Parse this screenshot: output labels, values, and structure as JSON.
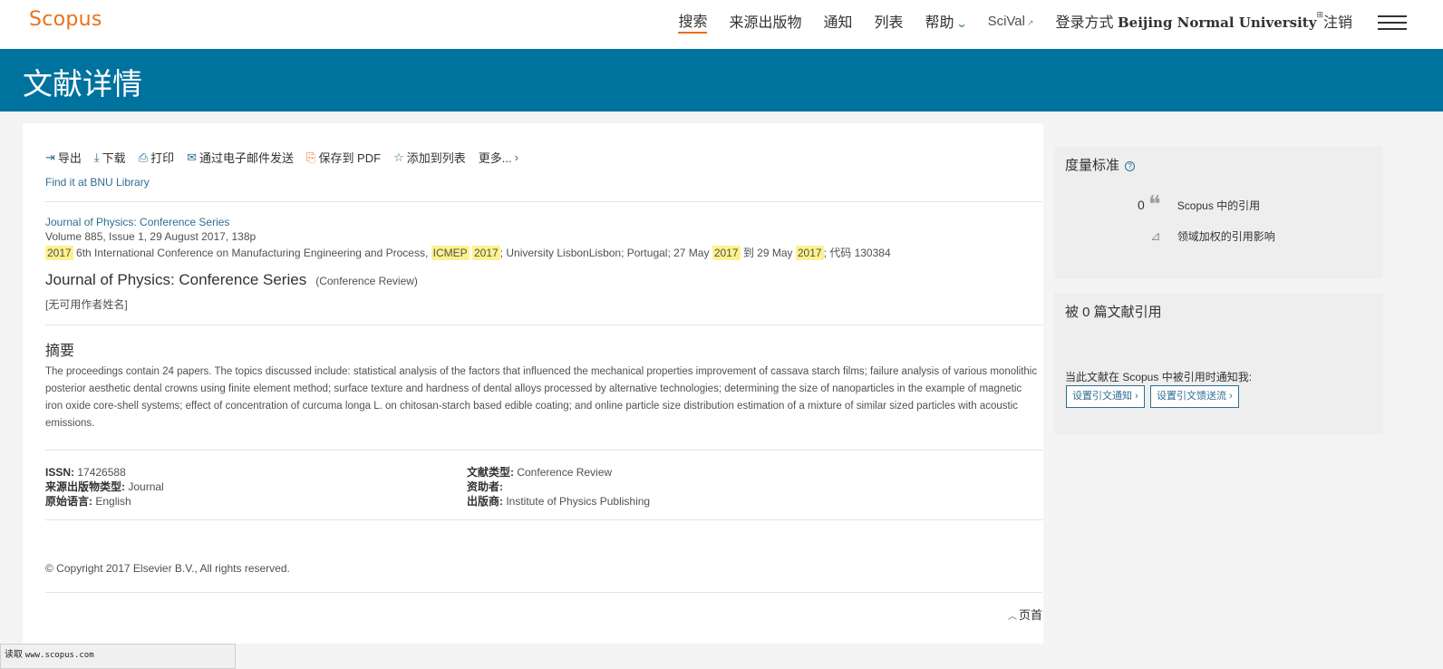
{
  "header": {
    "logo": "Scopus",
    "nav": [
      {
        "label": "搜索"
      },
      {
        "label": "来源出版物"
      },
      {
        "label": "通知"
      },
      {
        "label": "列表"
      },
      {
        "label": "帮助"
      }
    ],
    "scival": "SciVal",
    "login_prefix": "登录方式",
    "login_institution": "Beijing Normal University",
    "logout": "注销"
  },
  "banner": {
    "title": "文献详情"
  },
  "toolbar": {
    "export": "导出",
    "download": "下载",
    "print": "打印",
    "email": "通过电子邮件发送",
    "save_pdf": "保存到 PDF",
    "add_list": "添加到列表",
    "more": "更多..."
  },
  "find_library": "Find it at BNU Library",
  "record": {
    "source_link": "Journal of Physics: Conference Series",
    "volume_line": "Volume 885, Issue 1, 29 August 2017, 138p",
    "conf": {
      "y1": "2017",
      "t1": " 6th International Conference on Manufacturing Engineering and Process, ",
      "acr": "ICMEP",
      "y2": "2017",
      "t2": "; University LisbonLisbon; Portugal; 27 May ",
      "y3": "2017",
      "t3": " 到 29 May ",
      "y4": "2017",
      "t4": "; 代码 130384"
    },
    "title": "Journal of Physics: Conference Series",
    "doc_subtype": "(Conference Review)",
    "authors": "[无可用作者姓名]"
  },
  "abstract": {
    "heading": "摘要",
    "text": "The proceedings contain 24 papers. The topics discussed include: statistical analysis of the factors that influenced the mechanical properties improvement of cassava starch films; failure analysis of various monolithic posterior aesthetic dental crowns using finite element method; surface texture and hardness of dental alloys processed by alternative technologies; determining the size of nanoparticles in the example of magnetic iron oxide core-shell systems; effect of concentration of curcuma longa L. on chitosan-starch based edible coating; and online particle size distribution estimation of a mixture of similar sized particles with acoustic emissions."
  },
  "meta": {
    "issn_label": "ISSN:",
    "issn": "17426588",
    "source_type_label": "来源出版物类型:",
    "source_type": "Journal",
    "language_label": "原始语言:",
    "language": "English",
    "doc_type_label": "文献类型:",
    "doc_type": "Conference Review",
    "sponsor_label": "资助者:",
    "sponsor": "",
    "publisher_label": "出版商:",
    "publisher": "Institute of Physics Publishing"
  },
  "copyright": "© Copyright 2017 Elsevier B.V., All rights reserved.",
  "back_to_top": "页首",
  "metrics": {
    "heading": "度量标准",
    "citation_count": "0",
    "citation_label": "Scopus 中的引用",
    "fwci_label": "领域加权的引用影响"
  },
  "cited_by": {
    "heading": "被 0 篇文献引用",
    "notify_text": "当此文献在 Scopus 中被引用时通知我:",
    "alert_btn": "设置引文通知",
    "feed_btn": "设置引文馈送流"
  },
  "statusbar": {
    "prefix": "读取",
    "url": "www.scopus.com"
  },
  "colors": {
    "brand_orange": "#e9711c",
    "banner_blue": "#00729e",
    "link_blue": "#2e6e93",
    "highlight": "#fff28e"
  }
}
